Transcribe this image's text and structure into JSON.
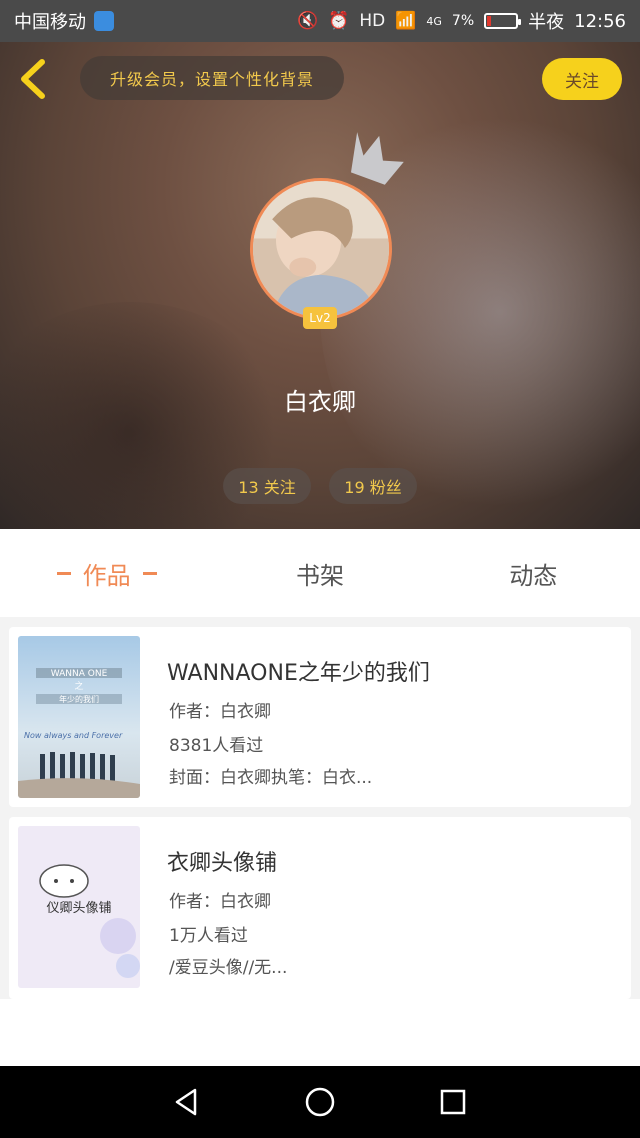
{
  "status_bar": {
    "carrier": "中国移动",
    "network": "4G",
    "battery_percent": "7%",
    "period": "半夜",
    "time": "12:56"
  },
  "header": {
    "notice": "升级会员，设置个性化背景",
    "follow_label": "关注",
    "level": "Lv2",
    "username": "白衣卿",
    "stats": {
      "following": "13 关注",
      "fans": "19 粉丝"
    }
  },
  "tabs": [
    {
      "label": "作品",
      "active": true
    },
    {
      "label": "书架",
      "active": false
    },
    {
      "label": "动态",
      "active": false
    }
  ],
  "works": [
    {
      "title": "WANNAONE之年少的我们",
      "author": "作者：白衣卿",
      "views": "8381人看过",
      "desc": "封面：白衣卿执笔：白衣...",
      "cover_text": [
        "WANNA ONE",
        "之",
        "年少的我们",
        "Now always and Forever"
      ]
    },
    {
      "title": "衣卿头像铺",
      "author": "作者：白衣卿",
      "views": "1万人看过",
      "desc": "/爱豆头像//无...",
      "cover_text": [
        "仪卿头像铺"
      ]
    }
  ],
  "colors": {
    "accent": "#f08a55",
    "gold": "#f2c94c",
    "button_yellow": "#f6d11c"
  }
}
